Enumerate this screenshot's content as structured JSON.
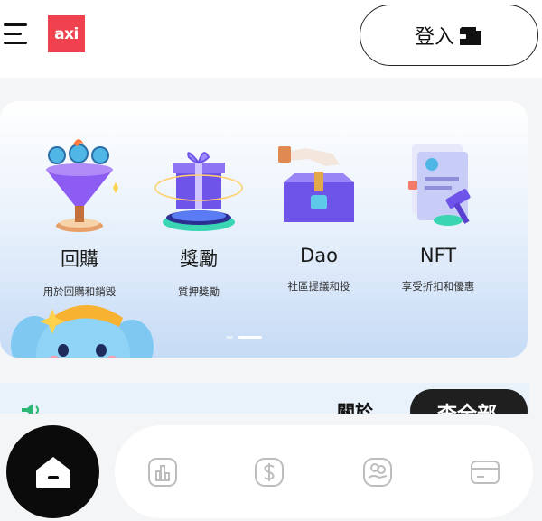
{
  "header": {
    "menu_icon": "hamburger-menu-icon",
    "logo_text": "axi",
    "login_label": "登入",
    "login_icon": "wallet-icon",
    "brand_color": "#f0414e"
  },
  "banner": {
    "features": [
      {
        "title": "回購",
        "subtitle": "用於回購和銷毀",
        "icon": "funnel-coins-icon"
      },
      {
        "title": "獎勵",
        "subtitle": "質押獎勵",
        "icon": "gift-box-icon"
      },
      {
        "title": "Dao",
        "subtitle": "社區提議和投",
        "icon": "ballot-box-icon"
      },
      {
        "title": "NFT",
        "subtitle": "享受折扣和優惠",
        "icon": "document-gavel-icon"
      }
    ],
    "mascot": "elephant-mascot",
    "slides": 2,
    "active_slide": 2
  },
  "notice": {
    "speaker_icon": "speaker-icon",
    "about_text": "關於",
    "see_all_label": "查全部"
  },
  "bottom_nav": {
    "items": [
      {
        "name": "home",
        "icon": "home-icon"
      },
      {
        "name": "chart",
        "icon": "bar-chart-icon"
      },
      {
        "name": "dollar",
        "icon": "dollar-icon"
      },
      {
        "name": "coins",
        "icon": "coins-hand-icon"
      },
      {
        "name": "card",
        "icon": "card-icon"
      }
    ]
  }
}
